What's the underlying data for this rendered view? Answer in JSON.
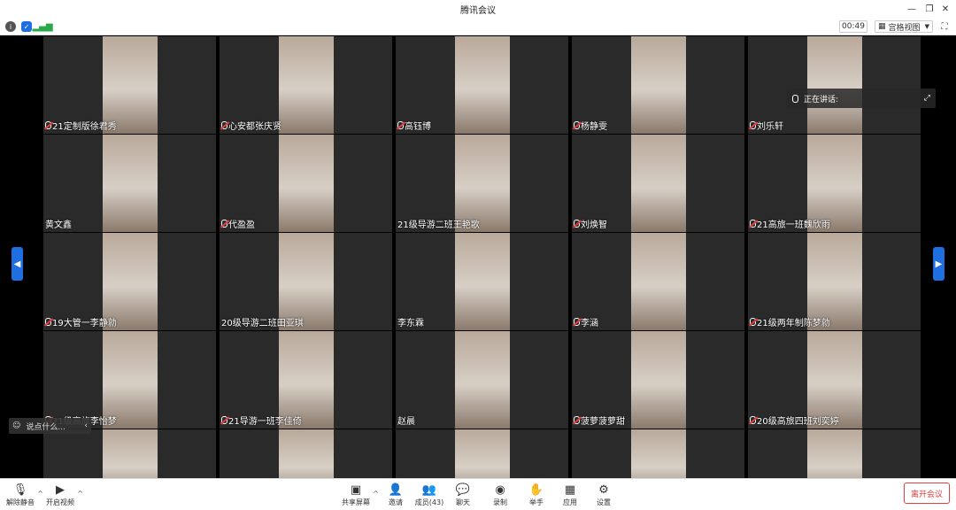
{
  "window": {
    "title": "腾讯会议"
  },
  "status": {
    "timer": "00:49",
    "view_label": "宫格视图"
  },
  "speaking": {
    "label": "正在讲话:"
  },
  "chat": {
    "placeholder": "说点什么..."
  },
  "participants": [
    {
      "name": "21定制版徐君秀",
      "muted": true
    },
    {
      "name": "心安都张庆贤",
      "muted": true
    },
    {
      "name": "高钰博",
      "muted": true
    },
    {
      "name": "杨静雯",
      "muted": true
    },
    {
      "name": "刘乐轩",
      "muted": true
    },
    {
      "name": "黄文鑫",
      "muted": false
    },
    {
      "name": "代盈盈",
      "muted": true
    },
    {
      "name": "21级导游二班王艳歌",
      "muted": false
    },
    {
      "name": "刘焕智",
      "muted": true
    },
    {
      "name": "21高旅一班魏欣雨",
      "muted": true
    },
    {
      "name": "19大管一李静勍",
      "muted": true
    },
    {
      "name": "20级导游二班田亚琪",
      "muted": false
    },
    {
      "name": "李东霖",
      "muted": false
    },
    {
      "name": "李涵",
      "muted": true
    },
    {
      "name": "21级两年制陈梦勍",
      "muted": true
    },
    {
      "name": "21级高旅李怡梦",
      "muted": true
    },
    {
      "name": "21导游一班李佳倚",
      "muted": true
    },
    {
      "name": "赵晨",
      "muted": false
    },
    {
      "name": "菠萝菠萝甜",
      "muted": true
    },
    {
      "name": "20级高旅四班刘奕婷",
      "muted": true
    },
    {
      "name": "",
      "muted": false
    },
    {
      "name": "",
      "muted": false
    },
    {
      "name": "",
      "muted": false
    },
    {
      "name": "",
      "muted": false
    },
    {
      "name": "",
      "muted": false
    }
  ],
  "toolbar": {
    "unmute": "解除静音",
    "start_video": "开启视频",
    "share": "共享屏幕",
    "invite": "邀请",
    "members": "成员(43)",
    "chat": "聊天",
    "record": "录制",
    "raise_hand": "举手",
    "apps": "应用",
    "settings": "设置",
    "leave": "离开会议"
  },
  "colors": {
    "accent": "#1f6fe0",
    "danger": "#e04040",
    "tile_bg": "#2a2a2a"
  }
}
